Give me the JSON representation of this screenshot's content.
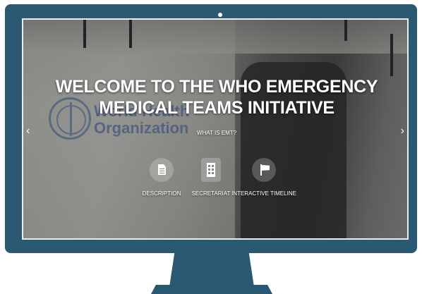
{
  "hero": {
    "headline_line1": "WELCOME TO THE WHO EMERGENCY",
    "headline_line2": "MEDICAL TEAMS INITIATIVE",
    "subtitle": "WHAT IS EMT?"
  },
  "background": {
    "logo_text_line1": "World Health",
    "logo_text_line2": "Organization"
  },
  "carousel": {
    "prev_arrow": "‹",
    "next_arrow": "›"
  },
  "nav": [
    {
      "label": "DESCRIPTION",
      "icon": "document-icon"
    },
    {
      "label": "SECRETARIAT",
      "icon": "building-icon"
    },
    {
      "label": "INTERACTIVE TIMELINE",
      "icon": "flag-icon"
    }
  ],
  "colors": {
    "monitor_frame": "#2b5873",
    "text": "#ffffff"
  }
}
